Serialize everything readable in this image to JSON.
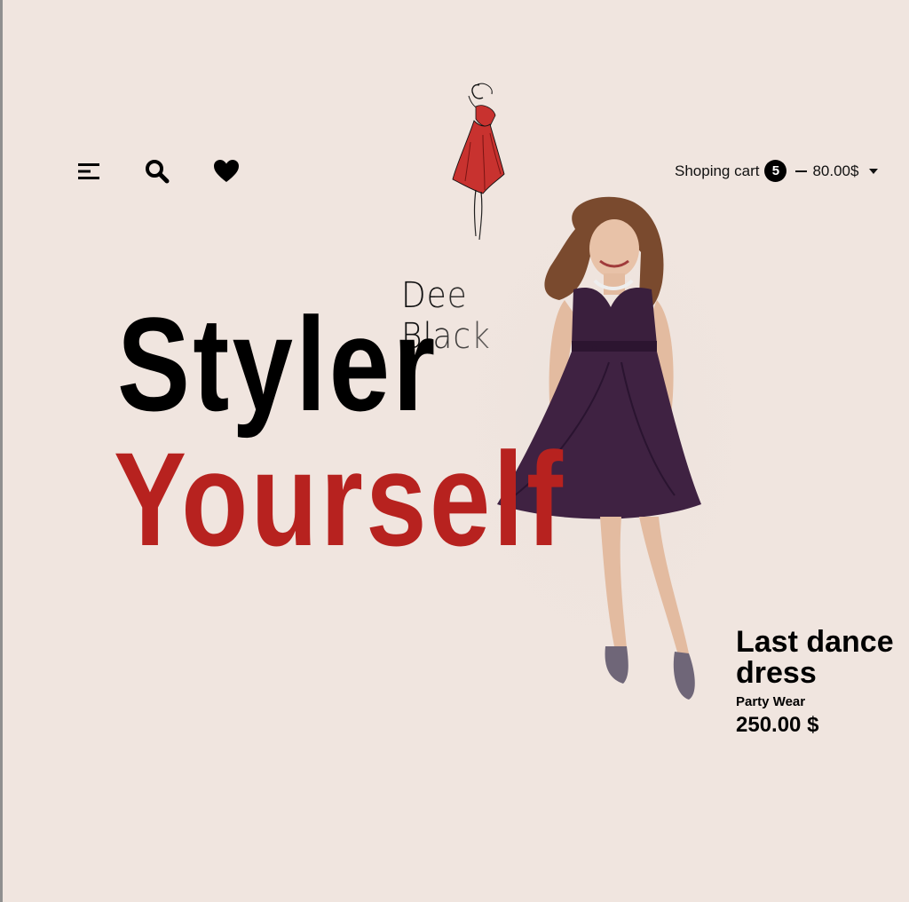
{
  "header": {
    "logo_text": "Dee Black",
    "cart": {
      "label": "Shoping cart",
      "count": "5",
      "total": "80.00$"
    }
  },
  "hero": {
    "line1": "Styler",
    "line2": "Yourself"
  },
  "product": {
    "name": "Last dance dress",
    "category": "Party Wear",
    "price": "250.00 $"
  },
  "icons": [
    "menu-icon",
    "search-icon",
    "heart-icon",
    "chevron-down-icon"
  ],
  "colors": {
    "background": "#f0e5df",
    "accent": "#b7221f",
    "dress": "#3a1f3d",
    "text": "#000000"
  }
}
